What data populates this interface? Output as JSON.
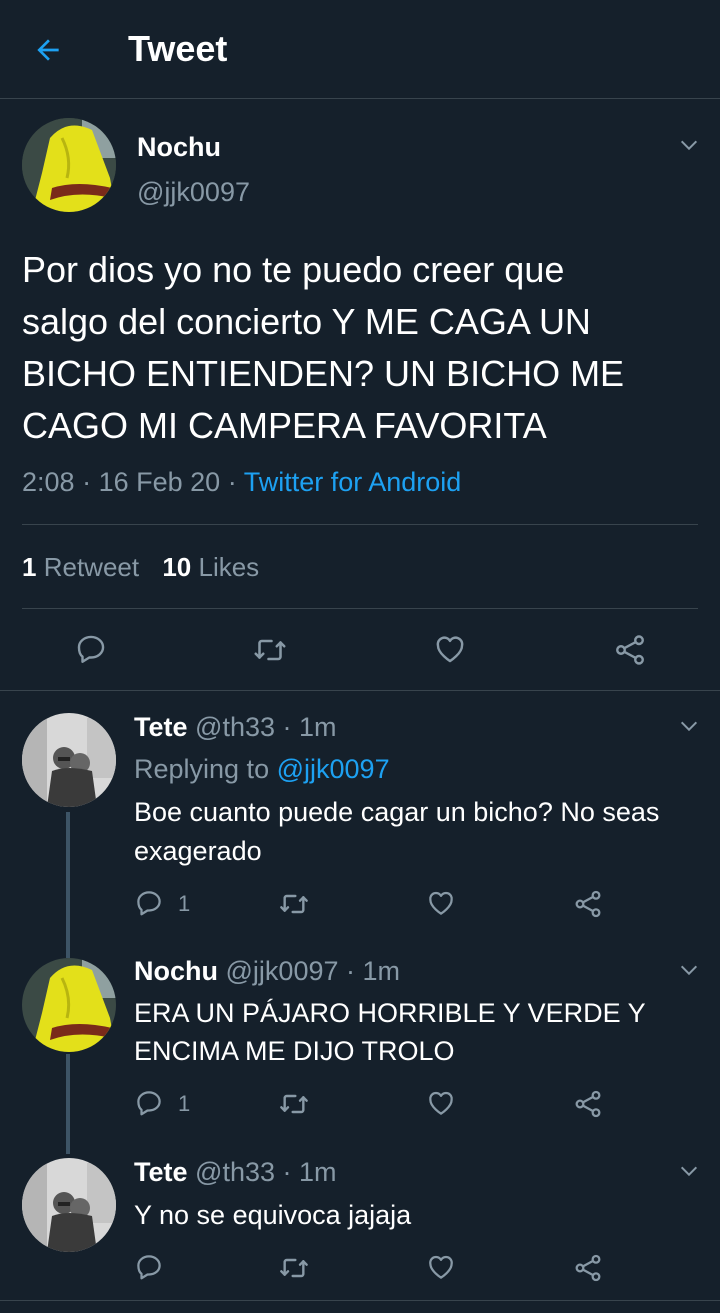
{
  "header": {
    "title": "Tweet",
    "back_icon": "arrow-left-icon"
  },
  "main_tweet": {
    "name": "Nochu",
    "handle": "@jjk0097",
    "text_lines": [
      "Por dios yo no te puedo creer que",
      "salgo del concierto Y ME CAGA UN",
      "BICHO ENTIENDEN? UN BICHO ME",
      "CAGO MI CAMPERA FAVORITA"
    ],
    "time": "2:08",
    "date": "16 Feb 20",
    "source": "Twitter for Android",
    "retweet_count": "1",
    "retweet_label": "Retweet",
    "like_count": "10",
    "like_label": "Likes"
  },
  "replies": [
    {
      "name": "Tete",
      "handle": "@th33",
      "time": "1m",
      "replying_label": "Replying to",
      "replying_to": "@jjk0097",
      "text_lines": [
        "Boe cuanto puede cagar un bicho? No seas",
        "exagerado"
      ],
      "reply_count": "1"
    },
    {
      "name": "Nochu",
      "handle": "@jjk0097",
      "time": "1m",
      "text_lines": [
        "ERA UN PÁJARO HORRIBLE Y VERDE Y",
        "ENCIMA ME DIJO TROLO"
      ],
      "reply_count": "1"
    },
    {
      "name": "Tete",
      "handle": "@th33",
      "time": "1m",
      "text_lines": [
        "Y no se equivoca jajaja"
      ]
    }
  ],
  "separator": "·",
  "colors": {
    "background": "#15202b",
    "text": "#ffffff",
    "muted": "#8899a6",
    "accent": "#1da1f2",
    "divider": "#38444d",
    "thread_line": "#3d5466"
  }
}
